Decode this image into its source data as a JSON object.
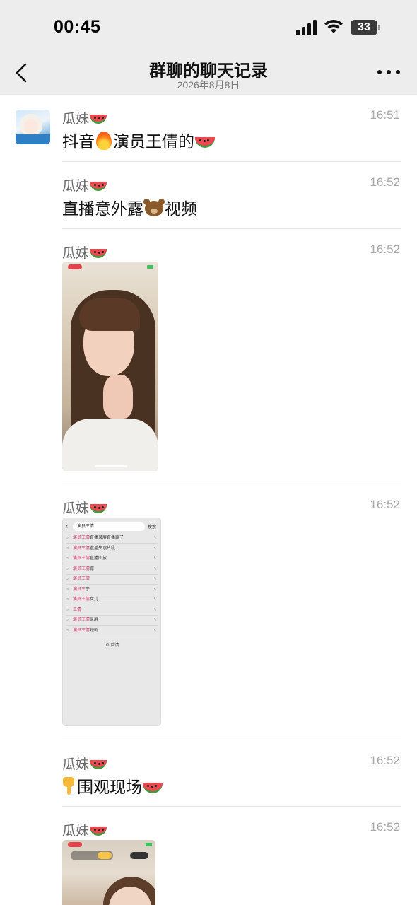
{
  "status": {
    "time": "00:45",
    "battery": "33"
  },
  "nav": {
    "title": "群聊的聊天记录",
    "date": "2026年8月8日"
  },
  "messages": [
    {
      "sender": "瓜妹",
      "time": "16:51",
      "text_a": "抖音",
      "text_b": "演员王倩的"
    },
    {
      "sender": "瓜妹",
      "time": "16:52",
      "text_a": "直播意外露",
      "text_b": "视频"
    },
    {
      "sender": "瓜妹",
      "time": "16:52"
    },
    {
      "sender": "瓜妹",
      "time": "16:52"
    },
    {
      "sender": "瓜妹",
      "time": "16:52",
      "text": "围观现场"
    },
    {
      "sender": "瓜妹",
      "time": "16:52"
    }
  ],
  "photo1": {
    "rec": "02:39"
  },
  "photo2": {
    "query": "演员王倩",
    "search_label": "搜索",
    "rows": [
      {
        "hl": "演员王倩",
        "rest": "直播录屏直播露了"
      },
      {
        "hl": "演员王倩",
        "rest": "直播失误片段"
      },
      {
        "hl": "演员王倩",
        "rest": "直播回放"
      },
      {
        "hl": "演员王倩",
        "rest": "露"
      },
      {
        "hl": "演员王倩",
        "rest": ""
      },
      {
        "hl": "演员王",
        "rest": "宁"
      },
      {
        "hl": "演员王倩",
        "rest": "女儿"
      },
      {
        "hl": "王倩",
        "rest": ""
      },
      {
        "hl": "演员王倩",
        "rest": "录屏"
      },
      {
        "hl": "演员王倩",
        "rest": "短剧"
      }
    ],
    "more": "⊙ 反馈"
  },
  "photo3": {
    "rec": "02:38"
  },
  "colors": {
    "nav_bg": "#ededed",
    "highlight": "#d4386c",
    "time_gray": "#a9a9a9"
  }
}
